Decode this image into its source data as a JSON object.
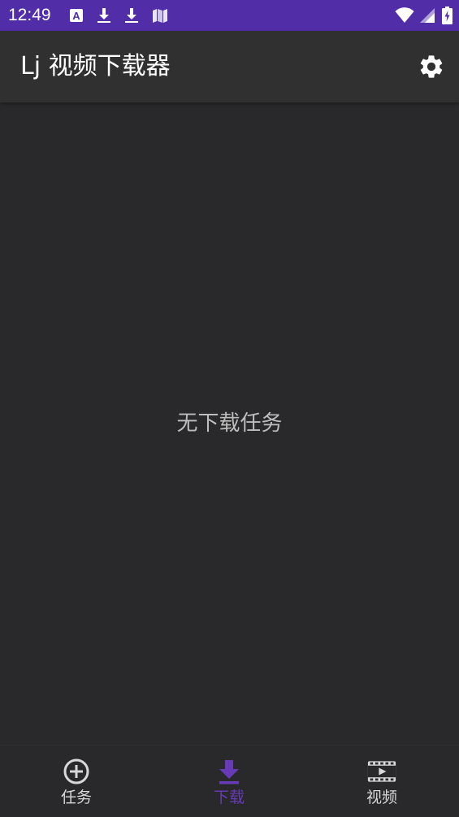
{
  "status_bar": {
    "time": "12:49",
    "background": "#512da8",
    "notification_icons": [
      "translate-a-icon",
      "download-icon",
      "download-icon",
      "map-icon"
    ],
    "system_icons": [
      "wifi-icon",
      "signal-icon",
      "battery-charging-icon"
    ]
  },
  "app_bar": {
    "title": "Lj 视频下载器",
    "settings_icon": "gear-icon"
  },
  "main": {
    "empty_message": "无下载任务"
  },
  "bottom_nav": {
    "active_color": "#673ab7",
    "inactive_color": "#d8d8d8",
    "active_index": 1,
    "items": [
      {
        "label": "任务",
        "icon": "add-circle-icon"
      },
      {
        "label": "下载",
        "icon": "download-icon"
      },
      {
        "label": "视频",
        "icon": "movie-icon"
      }
    ]
  }
}
